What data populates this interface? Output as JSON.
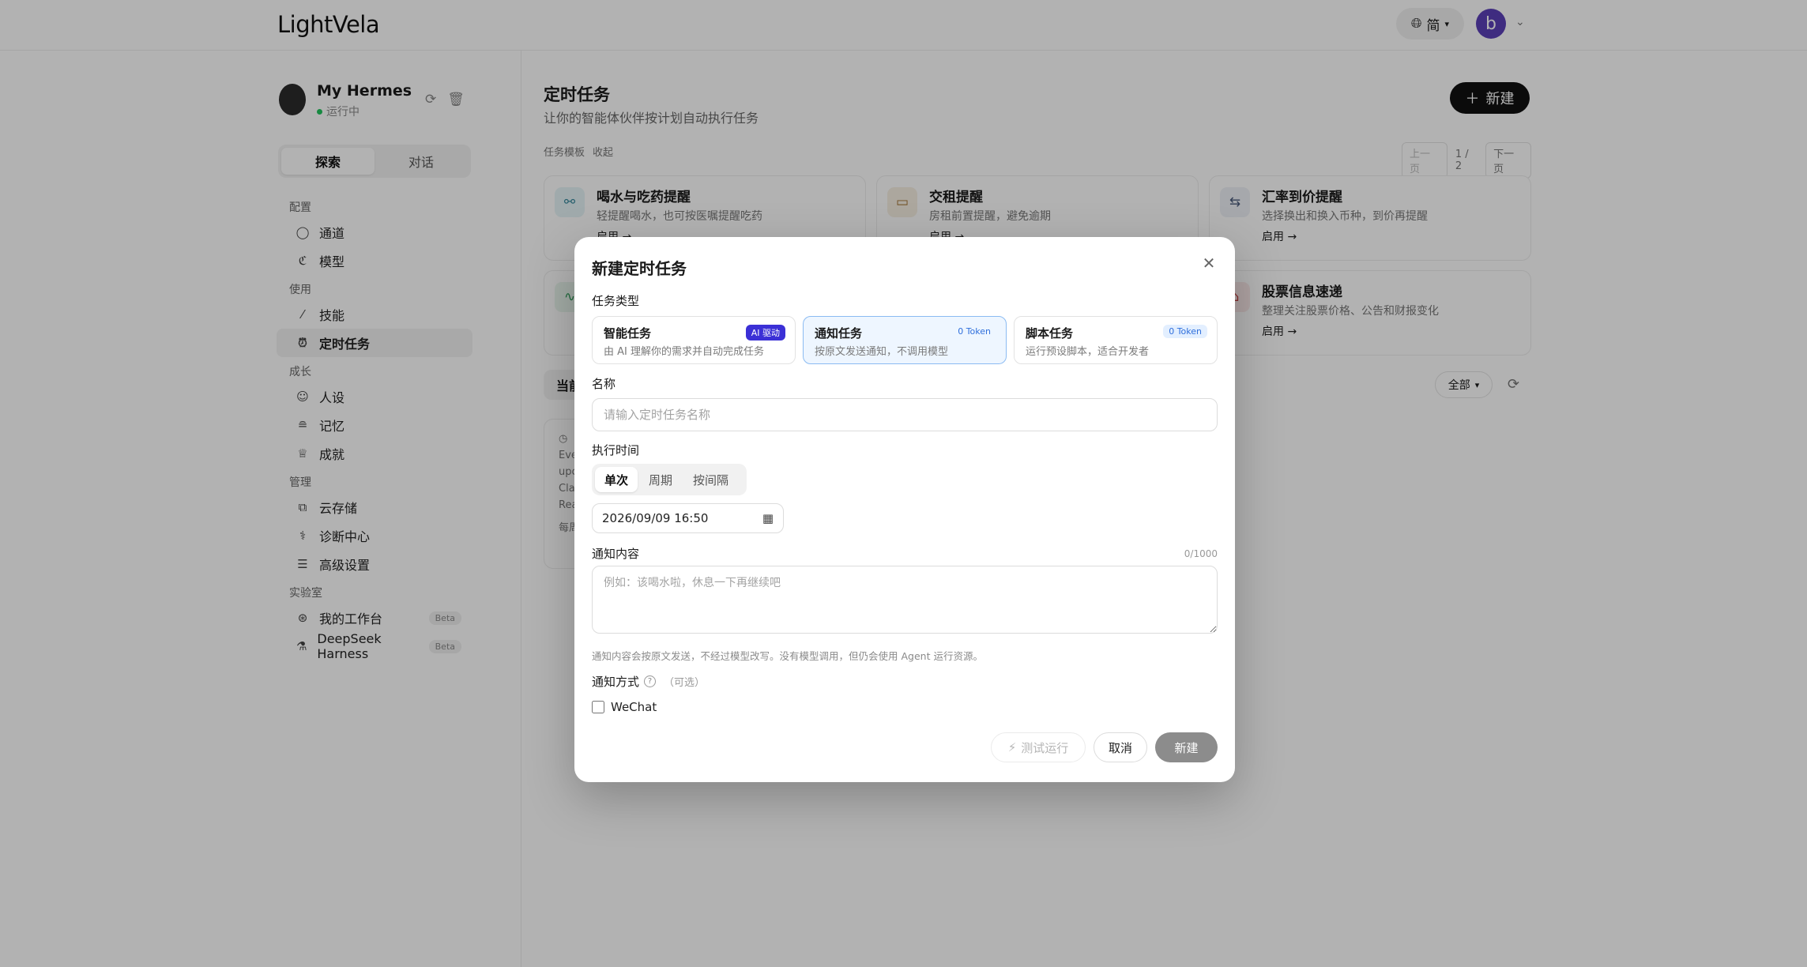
{
  "app": {
    "logo": "LightVela",
    "language_label": "简",
    "avatar_letter": "b",
    "avatar_color": "#5b3fb8"
  },
  "sidebar": {
    "agent_name": "My Hermes",
    "agent_status": "运行中",
    "tabs": [
      "探索",
      "对话"
    ],
    "groups": [
      {
        "title": "配置",
        "items": [
          {
            "label": "通道",
            "icon": "chat-bubble-icon"
          },
          {
            "label": "模型",
            "icon": "model-icon"
          }
        ]
      },
      {
        "title": "使用",
        "items": [
          {
            "label": "技能",
            "icon": "magic-wand-icon"
          },
          {
            "label": "定时任务",
            "icon": "alarm-clock-icon",
            "active": true
          }
        ]
      },
      {
        "title": "成长",
        "items": [
          {
            "label": "人设",
            "icon": "person-icon"
          },
          {
            "label": "记忆",
            "icon": "database-icon"
          },
          {
            "label": "成就",
            "icon": "trophy-icon"
          }
        ]
      },
      {
        "title": "管理",
        "items": [
          {
            "label": "云存储",
            "icon": "cloud-storage-icon"
          },
          {
            "label": "诊断中心",
            "icon": "diagnosis-icon"
          },
          {
            "label": "高级设置",
            "icon": "sliders-icon"
          }
        ]
      },
      {
        "title": "实验室",
        "items": [
          {
            "label": "我的工作台",
            "icon": "workbench-icon",
            "badge": "Beta"
          },
          {
            "label": "DeepSeek Harness",
            "icon": "flask-icon",
            "badge": "Beta"
          }
        ]
      }
    ]
  },
  "main": {
    "title": "定时任务",
    "subtitle": "让你的智能体伙伴按计划自动执行任务",
    "new_button": "新建",
    "templates_label": "任务模板",
    "collapse_label": "收起",
    "pager": {
      "prev": "上一页",
      "page": "1 / 2",
      "next": "下一页"
    },
    "templates": [
      {
        "title": "喝水与吃药提醒",
        "desc": "轻提醒喝水，也可按医嘱提醒吃药",
        "link": "启用 →",
        "icon": "link-icon"
      },
      {
        "title": "交租提醒",
        "desc": "房租前置提醒，避免逾期",
        "link": "启用 →",
        "icon": "card-icon"
      },
      {
        "title": "汇率到价提醒",
        "desc": "选择换出和换入币种，到价再提醒",
        "link": "启用 →",
        "icon": "exchange-icon"
      },
      {
        "title": "",
        "desc": "",
        "link": "",
        "icon": "pulse-icon"
      },
      {
        "title": "",
        "desc": "",
        "link": "",
        "icon": ""
      },
      {
        "title": "股票信息速递",
        "desc": "整理关注股票价格、公告和财报变化",
        "link": "启用 →",
        "icon": "stock-icon"
      }
    ],
    "current_tab": "当前",
    "filter_all": "全部",
    "task_card_lines": [
      "Eve",
      "upc",
      "Cla",
      "Rea",
      "每周"
    ]
  },
  "modal": {
    "title": "新建定时任务",
    "type_label": "任务类型",
    "types": [
      {
        "name": "智能任务",
        "desc": "由 AI 理解你的需求并自动完成任务",
        "badge": "AI 驱动"
      },
      {
        "name": "通知任务",
        "desc": "按原文发送通知，不调用模型",
        "badge": "0 Token",
        "selected": true
      },
      {
        "name": "脚本任务",
        "desc": "运行预设脚本，适合开发者",
        "badge": "0 Token"
      }
    ],
    "name_label": "名称",
    "name_placeholder": "请输入定时任务名称",
    "time_label": "执行时间",
    "schedule_modes": [
      "单次",
      "周期",
      "按间隔"
    ],
    "datetime": "2026/09/09 16:50",
    "content_label": "通知内容",
    "content_count": "0/1000",
    "content_placeholder": "例如：该喝水啦，休息一下再继续吧",
    "hint": "通知内容会按原文发送，不经过模型改写。没有模型调用，但仍会使用 Agent 运行资源。",
    "notify_label": "通知方式",
    "notify_optional": "（可选）",
    "channels": [
      {
        "label": "WeChat",
        "checked": false
      }
    ],
    "buttons": {
      "test": "测试运行",
      "cancel": "取消",
      "create": "新建"
    }
  }
}
